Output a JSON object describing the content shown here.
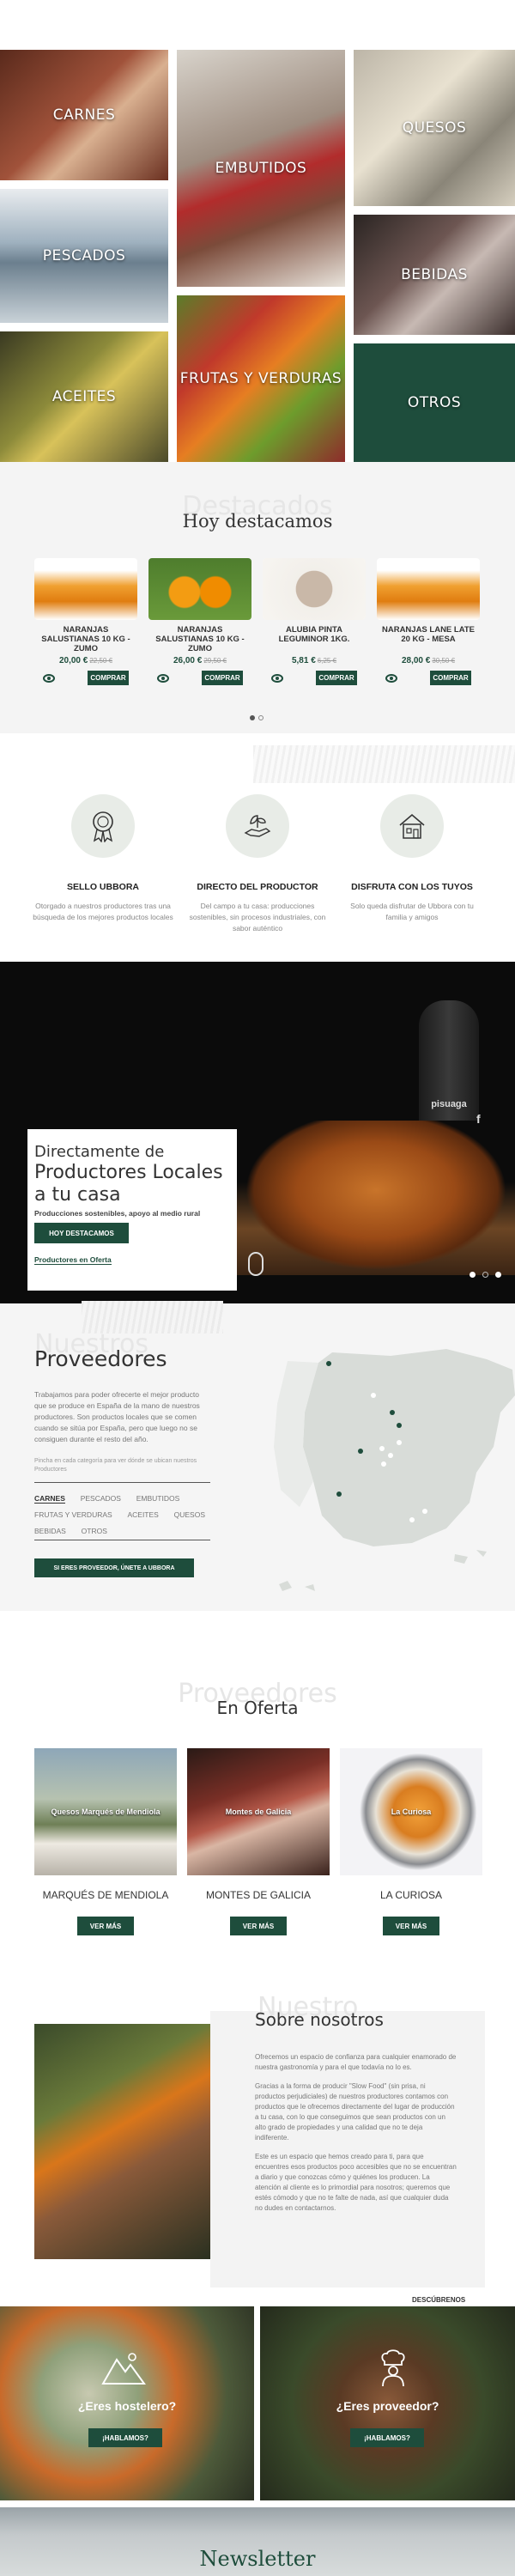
{
  "categories": [
    {
      "label": "CARNES"
    },
    {
      "label": "EMBUTIDOS"
    },
    {
      "label": "QUESOS"
    },
    {
      "label": "PESCADOS"
    },
    {
      "label": "BEBIDAS"
    },
    {
      "label": "ACEITES"
    },
    {
      "label": "FRUTAS Y VERDURAS"
    },
    {
      "label": "OTROS"
    }
  ],
  "featured": {
    "ghost": "Destacados",
    "title": "Hoy destacamos",
    "products": [
      {
        "name": "NARANJAS SALUSTIANAS 10 KG - ZUMO",
        "price": "20,00 €",
        "old_price": "22,50 €",
        "button": "COMPRAR"
      },
      {
        "name": "NARANJAS SALUSTIANAS 10 KG - ZUMO",
        "price": "26,00 €",
        "old_price": "29,50 €",
        "button": "COMPRAR"
      },
      {
        "name": "ALUBIA PINTA LEGUMINOR 1KG.",
        "price": "5,81 €",
        "old_price": "6,25 €",
        "button": "COMPRAR"
      },
      {
        "name": "NARANJAS LANE LATE 20 KG - MESA",
        "price": "28,00 €",
        "old_price": "30,50 €",
        "button": "COMPRAR"
      }
    ]
  },
  "features": [
    {
      "title": "SELLO UBBORA",
      "text": "Otorgado a nuestros productores tras una búsqueda de los mejores productos locales",
      "icon": "award-seal-icon"
    },
    {
      "title": "DIRECTO DEL PRODUCTOR",
      "text": "Del campo a tu casa: producciones sostenibles, sin procesos industriales, con sabor auténtico",
      "icon": "hand-plant-icon"
    },
    {
      "title": "DISFRUTA CON LOS TUYOS",
      "text": "Solo queda disfrutar de Ubbora con tu familia y amigos",
      "icon": "house-icon"
    }
  ],
  "hero": {
    "title_line1": "Directamente de",
    "title_line2": "Productores Locales",
    "title_line3": "a tu casa",
    "subtitle": "Producciones sostenibles, apoyo al medio rural",
    "button": "HOY DESTACAMOS",
    "link": "Productores en Oferta",
    "bottle_label": "pisuaga"
  },
  "suppliers": {
    "ghost": "Nuestros",
    "title": "Proveedores",
    "paragraph": "Trabajamos para poder ofrecerte el mejor producto que se produce en España de la mano de nuestros productores. Son productos locales que se comen cuando se sitúa por España, pero que luego no se consiguen durante el resto del año.",
    "hint": "Pincha en cada categoría para ver dónde se ubican nuestros Productores",
    "links": [
      "CARNES",
      "PESCADOS",
      "EMBUTIDOS",
      "FRUTAS Y VERDURAS",
      "ACEITES",
      "QUESOS",
      "BEBIDAS",
      "OTROS"
    ],
    "button": "SI ERES PROVEEDOR, ÚNETE A UBBORA"
  },
  "offers": {
    "ghost": "Proveedores",
    "title": "En Oferta",
    "items": [
      {
        "name": "MARQUÉS DE MENDIOLA",
        "overlay": "Quesos Marqués de Mendiola",
        "button": "VER MÁS"
      },
      {
        "name": "MONTES DE GALICIA",
        "overlay": "Montes de Galicia",
        "button": "VER MÁS"
      },
      {
        "name": "LA CURIOSA",
        "overlay": "La Curiosa",
        "button": "VER MÁS"
      }
    ]
  },
  "about": {
    "ghost": "Nuestro",
    "title": "Sobre nosotros",
    "p1": "Ofrecemos un espacio de confianza para cualquier enamorado de nuestra gastronomía y para el que todavía no lo es.",
    "p2": "Gracias a la forma de producir \"Slow Food\" (sin prisa, ni productos perjudiciales) de nuestros productores contamos con productos que le ofrecemos directamente del lugar de producción a tu casa, con lo que conseguimos que sean productos con un alto grado de propiedades y una calidad que no te deja indiferente.",
    "p3": "Este es un espacio que hemos creado para ti, para que encuentres esos productos poco accesibles que no se encuentran a diario y que conozcas cómo y quiénes los producen. La atención al cliente es lo primordial para nosotros; queremos que estés cómodo y que no te falte de nada, así que cualquier duda no dudes en contactarnos.",
    "link": "DESCÚBRENOS"
  },
  "cta": [
    {
      "title": "¿Eres hostelero?",
      "button": "¡HABLAMOS?",
      "icon": "mountain-icon"
    },
    {
      "title": "¿Eres proveedor?",
      "button": "¡HABLAMOS?",
      "icon": "chef-icon"
    }
  ],
  "newsletter": {
    "title": "Newsletter"
  },
  "colors": {
    "brand_green": "#1e4d3c"
  }
}
